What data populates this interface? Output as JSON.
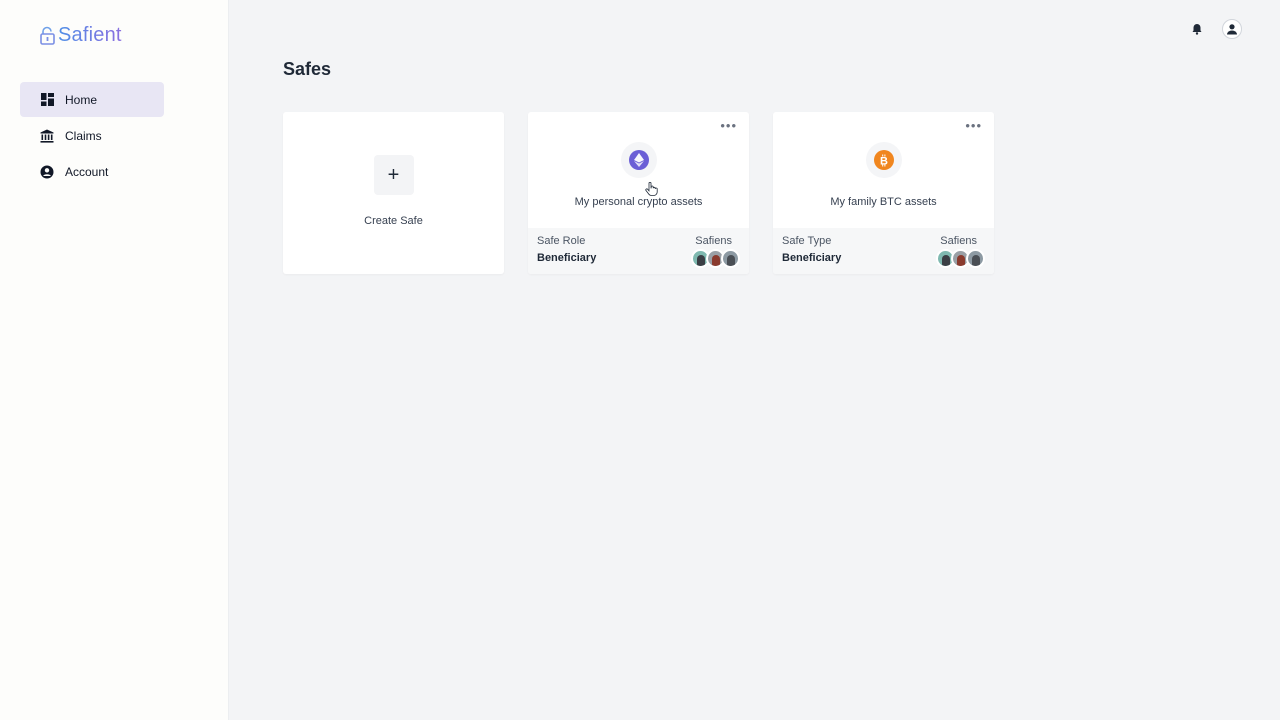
{
  "app": {
    "name": "Safient"
  },
  "sidebar": {
    "items": [
      {
        "label": "Home",
        "icon": "dashboard-icon",
        "active": true
      },
      {
        "label": "Claims",
        "icon": "bank-icon",
        "active": false
      },
      {
        "label": "Account",
        "icon": "account-circle-icon",
        "active": false
      }
    ]
  },
  "header": {
    "icons": [
      "bell-icon",
      "user-avatar-icon"
    ]
  },
  "main": {
    "title": "Safes",
    "create_label": "Create Safe",
    "create_icon": "+",
    "safes": [
      {
        "name": "My personal crypto assets",
        "coin": "ethereum-icon",
        "coin_color": "#6b5fd6",
        "left_key": "Safe Role",
        "left_value": "Beneficiary",
        "right_key": "Safiens"
      },
      {
        "name": "My family BTC assets",
        "coin": "bitcoin-icon",
        "coin_color": "#f0861f",
        "left_key": "Safe Type",
        "left_value": "Beneficiary",
        "right_key": "Safiens"
      }
    ],
    "more_label": "•••"
  },
  "colors": {
    "active_nav_bg": "#e8e6f4",
    "brand": "#5f86e6"
  }
}
